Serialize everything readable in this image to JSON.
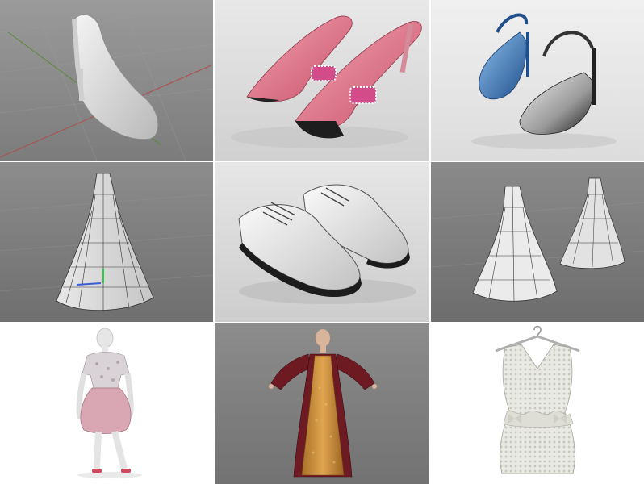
{
  "gallery": {
    "tiles": [
      {
        "subject": "white-high-heel-pump"
      },
      {
        "subject": "pink-peep-toe-heels"
      },
      {
        "subject": "blue-slingback-heels"
      },
      {
        "subject": "wireframe-dress-single"
      },
      {
        "subject": "white-oxford-shoes"
      },
      {
        "subject": "wireframe-dresses-pair"
      },
      {
        "subject": "mannequin-pink-dress"
      },
      {
        "subject": "medieval-gown-figure"
      },
      {
        "subject": "lace-dress-on-hanger"
      }
    ]
  },
  "colors": {
    "viewport_gray": "#8a8a8a",
    "studio_gray": "#d9d9d9",
    "white_bg": "#ffffff",
    "pink_satin": "#e2778a",
    "blue_satin": "#3f78b8",
    "gown_red": "#6e1a22",
    "gown_gold": "#c8893a"
  }
}
